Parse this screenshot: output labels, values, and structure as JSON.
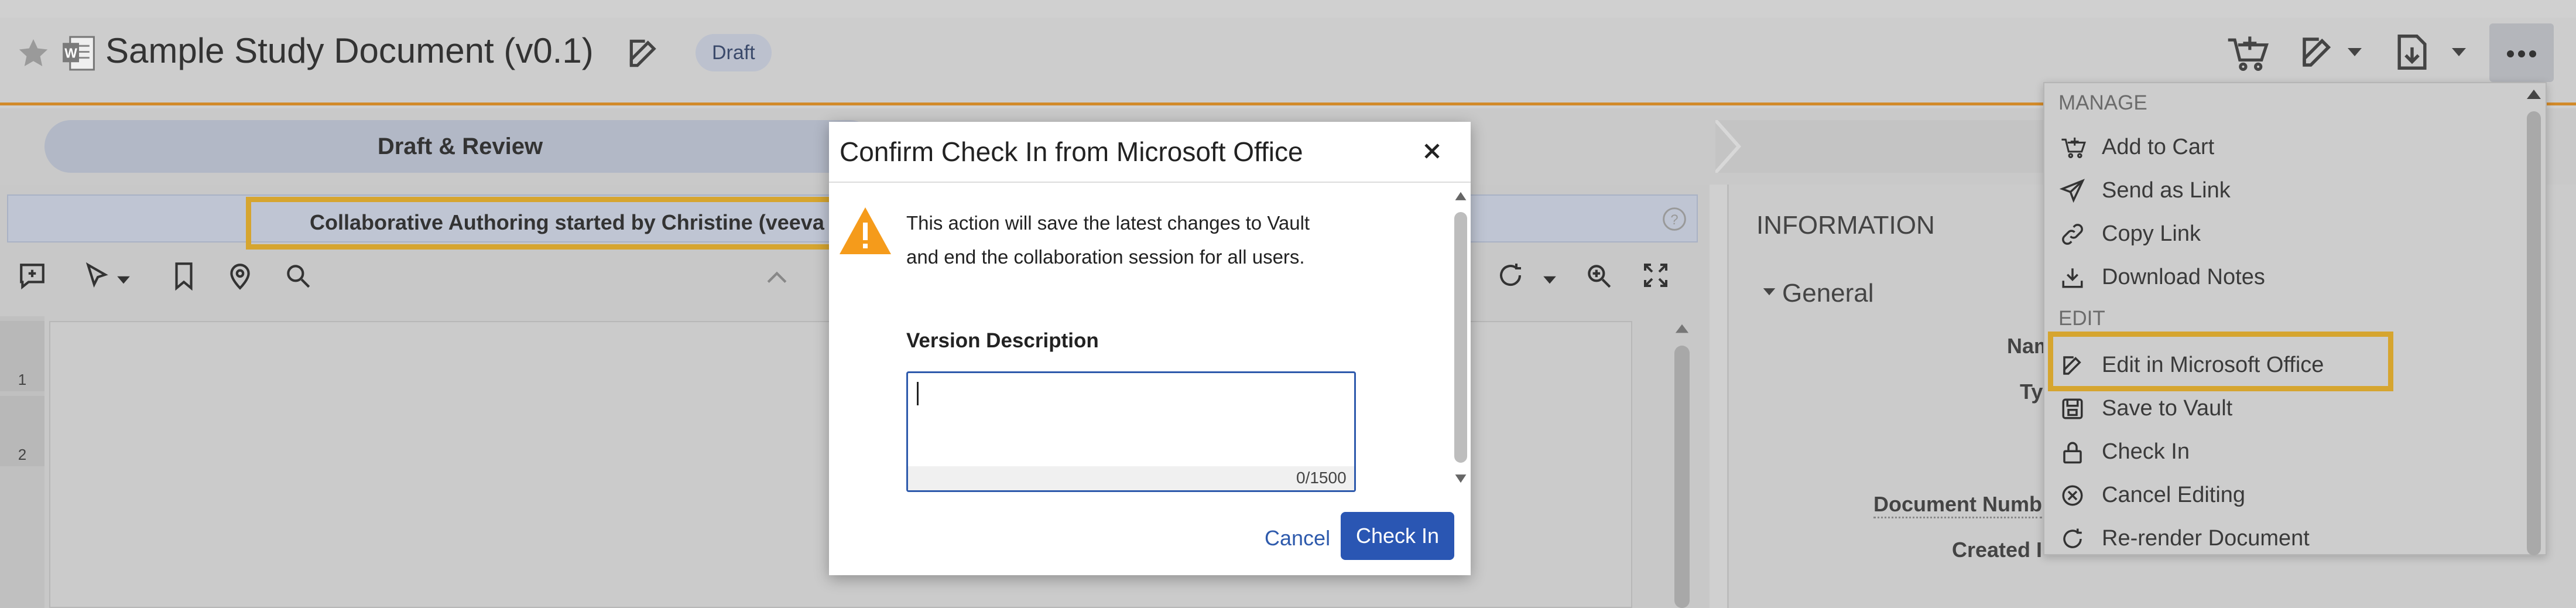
{
  "header": {
    "title": "Sample Study Document (v0.1)",
    "status_badge": "Draft"
  },
  "workflow": {
    "stage": "Draft & Review"
  },
  "banner": {
    "text": "Collaborative Authoring started by Christine (veeva"
  },
  "page_numbers": [
    "1",
    "2"
  ],
  "info_panel": {
    "title": "INFORMATION",
    "section": "General",
    "fields": [
      "Nam",
      "Typ",
      "Document Numb",
      "Created I"
    ]
  },
  "menu": {
    "sections": [
      {
        "label": "MANAGE",
        "items": [
          {
            "label": "Add to Cart",
            "icon": "cart-icon"
          },
          {
            "label": "Send as Link",
            "icon": "send-icon"
          },
          {
            "label": "Copy Link",
            "icon": "link-icon"
          },
          {
            "label": "Download Notes",
            "icon": "download-icon"
          }
        ]
      },
      {
        "label": "EDIT",
        "items": [
          {
            "label": "Edit in Microsoft Office",
            "icon": "edit-icon"
          },
          {
            "label": "Save to Vault",
            "icon": "save-icon"
          },
          {
            "label": "Check In",
            "icon": "lock-icon"
          },
          {
            "label": "Cancel Editing",
            "icon": "cancel-icon"
          },
          {
            "label": "Re-render Document",
            "icon": "refresh-icon"
          }
        ]
      }
    ]
  },
  "dialog": {
    "title": "Confirm Check In from Microsoft Office",
    "message": "This action will save the latest changes to Vault and end the collaboration session for all users.",
    "version_label": "Version Description",
    "version_value": "",
    "char_count": "0/1500",
    "cancel_label": "Cancel",
    "checkin_label": "Check In"
  },
  "colors": {
    "highlight": "#d6a52f",
    "primary": "#2a56b3",
    "header_rule": "#d28a2a",
    "warning": "#f59b1b"
  }
}
